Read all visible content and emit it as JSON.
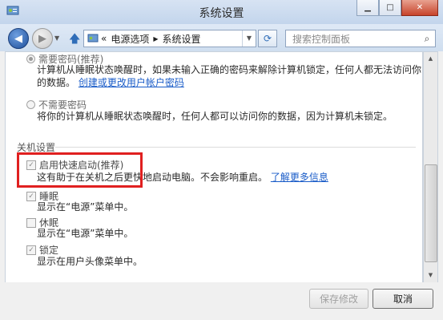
{
  "window": {
    "title": "系统设置"
  },
  "nav": {
    "breadcrumb_prefix": "«",
    "breadcrumb": [
      "电源选项",
      "系统设置"
    ],
    "search_placeholder": "搜索控制面板"
  },
  "password": {
    "require_label": "需要密码(推荐)",
    "require_desc_line1": "计算机从睡眠状态唤醒时，如果未输入正确的密码来解除计算机锁定，任何人都无法访问你",
    "require_desc_line2": "的数据。",
    "create_link": "创建或更改用户帐户密码",
    "norequire_label": "不需要密码",
    "norequire_desc": "将你的计算机从睡眠状态唤醒时，任何人都可以访问你的数据，因为计算机未锁定。"
  },
  "shutdown": {
    "section_title": "关机设置",
    "fast_startup": {
      "label": "启用快速启动(推荐)",
      "desc": "这有助于在关机之后更快地启动电脑。不会影响重启。",
      "link": "了解更多信息",
      "checked": true
    },
    "sleep": {
      "label": "睡眠",
      "desc": "显示在“电源”菜单中。",
      "checked": true
    },
    "hibernate": {
      "label": "休眠",
      "desc": "显示在“电源”菜单中。",
      "checked": false
    },
    "lock": {
      "label": "锁定",
      "desc": "显示在用户头像菜单中。",
      "checked": true
    }
  },
  "buttons": {
    "save": "保存修改",
    "cancel": "取消"
  },
  "colors": {
    "highlight_box": "#e02020",
    "link": "#1a5cc8"
  }
}
